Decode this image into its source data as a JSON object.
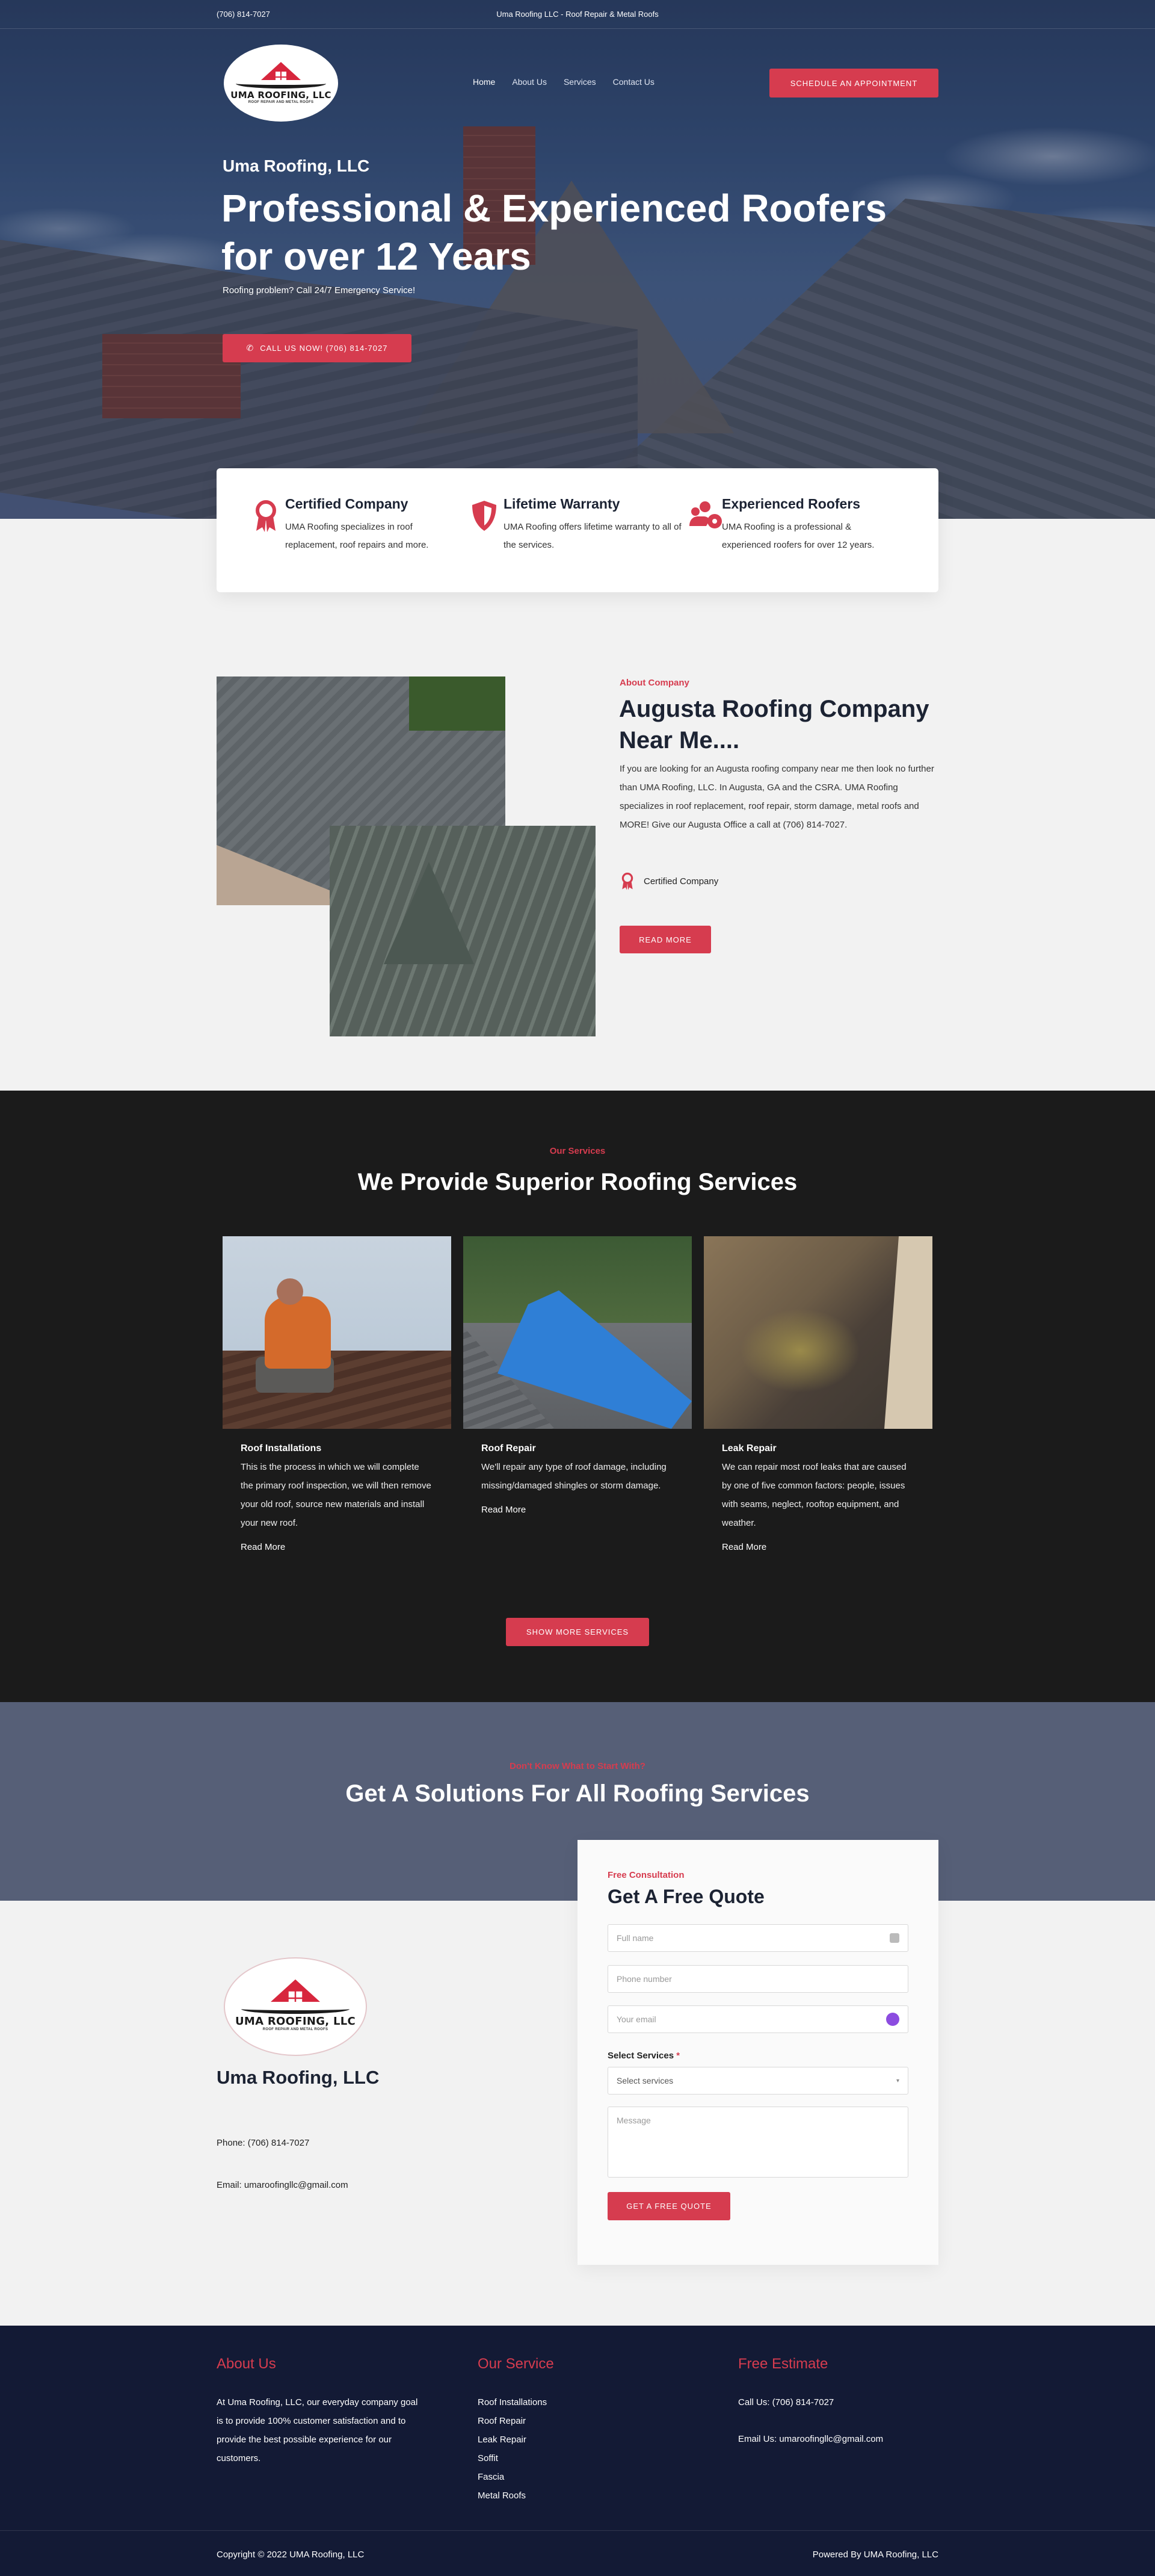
{
  "topbar": {
    "phone": "(706) 814-7027",
    "tagline": "Uma Roofing LLC - Roof Repair & Metal Roofs"
  },
  "logo": {
    "name": "UMA ROOFING, LLC",
    "sub": "ROOF REPAIR AND METAL ROOFS"
  },
  "nav": {
    "items": [
      "Home",
      "About Us",
      "Services",
      "Contact Us"
    ],
    "appointment": "SCHEDULE AN APPOINTMENT"
  },
  "hero": {
    "brand": "Uma Roofing, LLC",
    "title": "Professional & Experienced Roofers for over 12 Years",
    "subtitle": "Roofing problem? Call 24/7 Emergency Service!",
    "call_button": "CALL US NOW! (706) 814-7027"
  },
  "features": [
    {
      "title": "Certified Company",
      "text": "UMA Roofing specializes in roof replacement, roof repairs and more.",
      "icon": "award-ribbon-icon"
    },
    {
      "title": "Lifetime Warranty",
      "text": "UMA Roofing offers lifetime warranty to all of the services.",
      "icon": "shield-icon"
    },
    {
      "title": "Experienced Roofers",
      "text": "UMA Roofing is a professional & experienced roofers for over 12 years.",
      "icon": "users-gear-icon"
    }
  ],
  "about": {
    "eyebrow": "About Company",
    "title": "Augusta Roofing Company Near Me....",
    "text": "If you are looking for an Augusta roofing company near me then look no further than UMA Roofing, LLC. In Augusta, GA and the CSRA. UMA Roofing specializes in roof replacement, roof repair, storm damage, metal roofs and MORE! Give our Augusta Office a call at (706) 814-7027.",
    "badge": "Certified Company",
    "read_more": "READ MORE"
  },
  "services": {
    "eyebrow": "Our Services",
    "title": "We Provide Superior Roofing Services",
    "cards": [
      {
        "title": "Roof Installations",
        "text": "This is the process in which we will complete the primary roof inspection, we will then remove your old roof, source new materials and install your new roof.",
        "link": "Read More"
      },
      {
        "title": "Roof Repair",
        "text": "We'll repair any type of roof damage, including missing/damaged shingles or storm damage.",
        "link": "Read More"
      },
      {
        "title": "Leak Repair",
        "text": "We can repair most roof leaks that are caused by one of five common factors: people, issues with seams, neglect, rooftop equipment, and weather.",
        "link": "Read More"
      }
    ],
    "show_more": "SHOW MORE SERVICES"
  },
  "solutions": {
    "eyebrow": "Don't Know What to Start With?",
    "title": "Get A Solutions For All Roofing Services"
  },
  "contact": {
    "name": "Uma Roofing, LLC",
    "phone": "Phone: (706) 814-7027",
    "email": "Email: umaroofingllc@gmail.com"
  },
  "quote": {
    "eyebrow": "Free Consultation",
    "title": "Get A Free Quote",
    "full_name_placeholder": "Full name",
    "phone_placeholder": "Phone number",
    "email_placeholder": "Your email",
    "services_label": "Select Services",
    "required_mark": "*",
    "services_selected": "Select services",
    "message_placeholder": "Message",
    "submit": "GET A FREE QUOTE"
  },
  "footer": {
    "about_title": "About Us",
    "about_text": "At Uma Roofing, LLC, our everyday company goal is to provide 100% customer satisfaction and to provide the best possible experience for our customers.",
    "service_title": "Our Service",
    "service_links": [
      "Roof Installations",
      "Roof Repair",
      "Leak Repair",
      "Soffit",
      "Fascia",
      "Metal Roofs"
    ],
    "estimate_title": "Free Estimate",
    "call": "Call Us: (706) 814-7027",
    "email": "Email Us: umaroofingllc@gmail.com",
    "copyright": "Copyright © 2022 UMA Roofing, LLC",
    "powered": "Powered By UMA Roofing, LLC"
  },
  "colors": {
    "accent": "#d63c4f",
    "navy": "#131a35",
    "dark": "#1b1b1b",
    "slate": "#565f77"
  }
}
